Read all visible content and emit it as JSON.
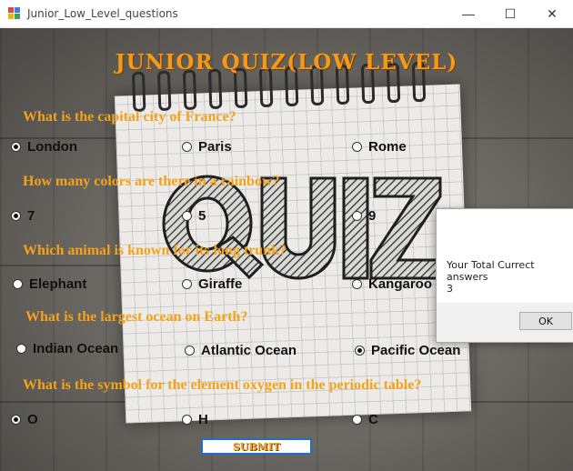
{
  "window": {
    "title": "Junior_Low_Level_questions",
    "minimize_glyph": "—",
    "maximize_glyph": "☐",
    "close_glyph": "✕"
  },
  "quiz": {
    "heading": "JUNIOR QUIZ(LOW LEVEL)",
    "questions": [
      {
        "text": "What is the capital city of France?",
        "options": [
          "London",
          "Paris",
          "Rome"
        ],
        "selected": 0
      },
      {
        "text": "How many colors are there in a rainbow?",
        "options": [
          "7",
          "5",
          "9"
        ],
        "selected": 0
      },
      {
        "text": "Which animal is known for its long trunk?",
        "options": [
          "Elephant",
          "Giraffe",
          "Kangaroo"
        ],
        "selected": null
      },
      {
        "text": "What is the largest ocean on Earth?",
        "options": [
          "Indian Ocean",
          "Atlantic Ocean",
          "Pacific Ocean"
        ],
        "selected": 2
      },
      {
        "text": "What is the symbol for the element oxygen in the periodic table?",
        "options": [
          "O",
          "H",
          "C"
        ],
        "selected": 0
      }
    ],
    "submit_label": "SUBMIT"
  },
  "message_box": {
    "line1": "Your Total Currect answers",
    "line2": "3",
    "ok_label": "OK"
  },
  "colors": {
    "question_text": "#f4a21c",
    "heading_text": "#f29b19",
    "submit_border": "#1f6fc3"
  }
}
